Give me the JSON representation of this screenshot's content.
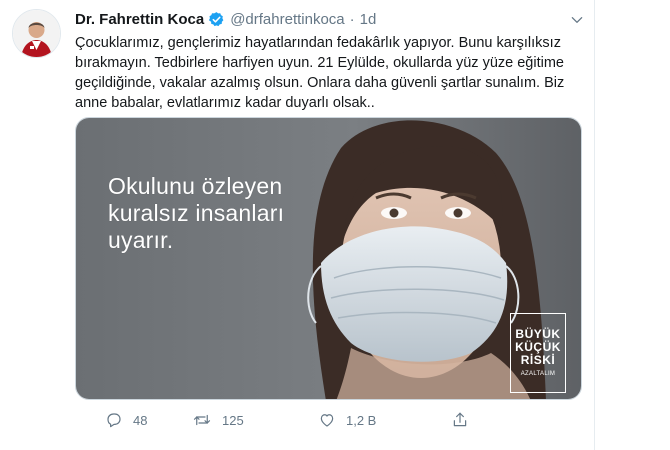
{
  "tweet": {
    "author_name": "Dr. Fahrettin Koca",
    "handle": "@drfahrettinkoca",
    "separator": "·",
    "time": "1d",
    "text": "Çocuklarımız, gençlerimiz hayatlarından fedakârlık yapıyor. Bunu karşılıksız bırakmayın. Tedbirlere harfiyen uyun. 21 Eylülde, okullarda yüz yüze eğitime geçildiğinde, vakalar azalmış olsun. Onlara daha güvenli şartlar sunalım. Biz anne babalar, evlatlarımız kadar duyarlı olsak..",
    "verified_icon": "verified-badge-icon",
    "verified_color": "#1da1f2"
  },
  "media": {
    "overlay_text": "Okulunu özleyen\nkuralsız insanları\nuyarır.",
    "logo": {
      "line1": "BÜYÜK",
      "line2": "KÜÇÜK",
      "line3": "RİSKİ",
      "line4": "AZALTALIM"
    }
  },
  "actions": {
    "reply_count": "48",
    "retweet_count": "125",
    "like_count": "1,2 B",
    "icons": [
      "reply-icon",
      "retweet-icon",
      "like-icon",
      "share-icon"
    ]
  },
  "colors": {
    "text": "#14171a",
    "secondary": "#657786",
    "accent": "#1da1f2"
  }
}
